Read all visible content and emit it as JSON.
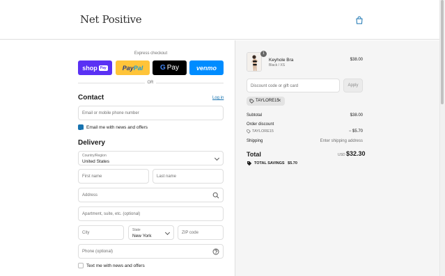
{
  "header": {
    "logo": "Net Positive",
    "cart_icon": "shopping-bag-icon"
  },
  "express": {
    "title": "Express checkout",
    "shop_label": "shop",
    "shop_badge": "Pay",
    "paypal_a": "Pay",
    "paypal_b": "Pal",
    "gpay_g": "G",
    "gpay_label": "Pay",
    "venmo_label": "venmo",
    "or": "OR"
  },
  "contact": {
    "title": "Contact",
    "login": "Log in",
    "email_placeholder": "Email or mobile phone number",
    "newsletter_label": "Email me with news and offers",
    "newsletter_checked": true
  },
  "delivery": {
    "title": "Delivery",
    "country_label": "Country/Region",
    "country_value": "United States",
    "first_name": "First name",
    "last_name": "Last name",
    "address": "Address",
    "apartment": "Apartment, suite, etc. (optional)",
    "city": "City",
    "state_label": "State",
    "state_value": "New York",
    "zip": "ZIP code",
    "phone": "Phone (optional)",
    "sms_label": "Text me with news and offers",
    "sms_checked": false
  },
  "summary": {
    "item": {
      "name": "Keyhole Bra",
      "variant": "Black / XS",
      "price": "$38.00",
      "quantity": "1"
    },
    "discount_placeholder": "Discount code or gift card",
    "apply": "Apply",
    "applied_code": "TAYLORE15",
    "subtotal_label": "Subtotal",
    "subtotal": "$38.00",
    "order_discount_label": "Order discount",
    "discount_code": "TAYLORE15",
    "discount_amount": "− $5.70",
    "shipping_label": "Shipping",
    "shipping_value": "Enter shipping address",
    "total_label": "Total",
    "currency": "USD",
    "total": "$32.30",
    "savings_label": "TOTAL SAVINGS",
    "savings_amount": "$5.70"
  },
  "colors": {
    "accent": "#1773b0",
    "shop_pay": "#5a31f4",
    "paypal": "#ffc439",
    "venmo": "#008cff"
  }
}
